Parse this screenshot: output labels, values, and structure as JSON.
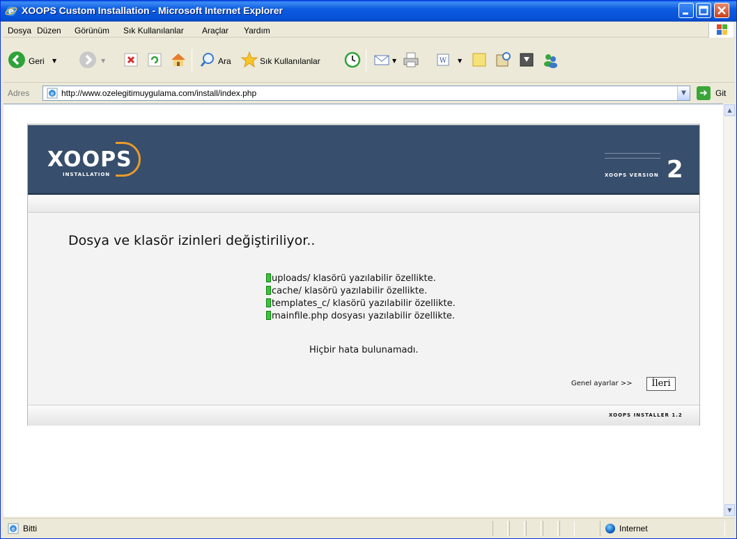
{
  "window": {
    "title": "XOOPS Custom Installation - Microsoft Internet Explorer"
  },
  "menu": {
    "items": [
      "Dosya",
      "Düzen",
      "Görünüm",
      "Sık Kullanılanlar",
      "Araçlar",
      "Yardım"
    ]
  },
  "toolbar": {
    "back_label": "Geri",
    "search_label": "Ara",
    "favorites_label": "Sık Kullanılanlar"
  },
  "address": {
    "label": "Adres",
    "url": "http://www.ozelegitimuygulama.com/install/index.php",
    "go_label": "Git"
  },
  "installer": {
    "logo_text": "XOOPS",
    "logo_sub": "INSTALLATION",
    "version_text": "XOOPS VERSION",
    "version_num": "2",
    "heading": "Dosya ve klasör izinleri değiştiriliyor..",
    "permissions": [
      "uploads/ klasörü yazılabilir özellikte.",
      "cache/ klasörü yazılabilir özellikte.",
      "templates_c/ klasörü yazılabilir özellikte.",
      "mainfile.php dosyası yazılabilir özellikte."
    ],
    "no_error": "Hiçbir hata bulunamadı.",
    "next_label": "Genel ayarlar >>",
    "next_button": "İleri",
    "footer": "XOOPS INSTALLER 1.2"
  },
  "status": {
    "text": "Bitti",
    "zone": "Internet"
  },
  "colors": {
    "title_bar": "#0a5ee6",
    "header_bg": "#374e6c",
    "accent_arc": "#e79b2b",
    "ok_mark": "#2ecc2e"
  },
  "icons": {
    "back": "back-arrow-icon",
    "forward": "forward-arrow-icon",
    "stop": "stop-icon",
    "refresh": "refresh-icon",
    "home": "home-icon",
    "search": "search-icon",
    "favorites": "star-icon",
    "history": "history-icon",
    "mail": "mail-icon",
    "print": "print-icon",
    "edit": "word-icon",
    "discuss": "notes-icon",
    "research": "research-icon",
    "messenger": "messenger-icon"
  }
}
